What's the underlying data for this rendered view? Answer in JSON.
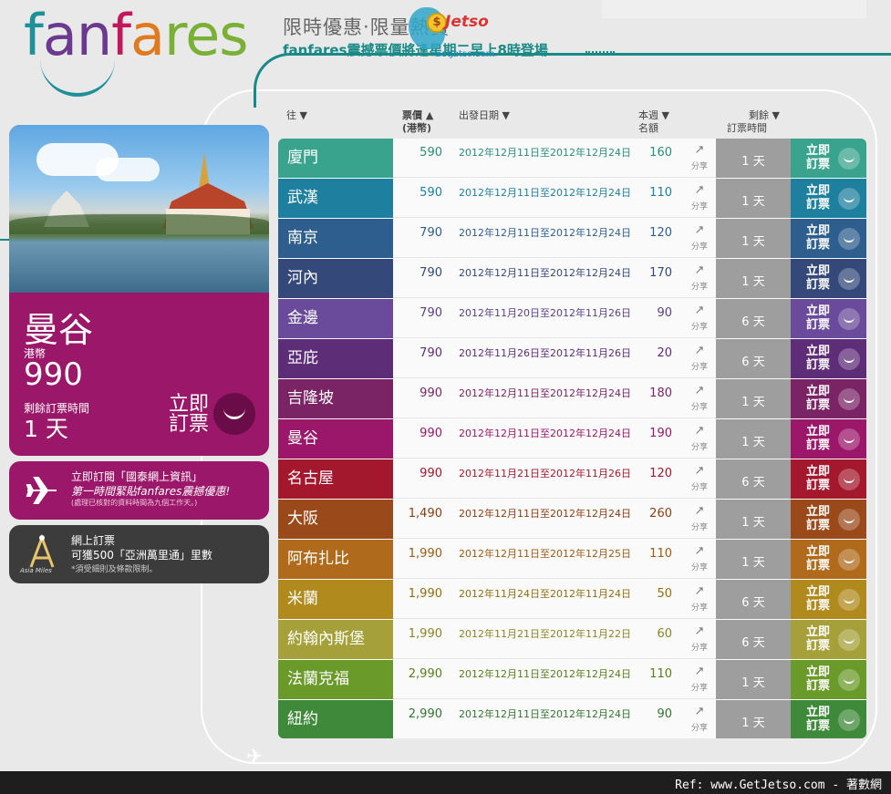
{
  "logo": {
    "parts": [
      "f",
      "an",
      "f",
      "a",
      "res"
    ]
  },
  "promo": {
    "title": "限時優惠‧限量熱賣",
    "subtitle": "fanfares震撼票價將逢星期二早上8時登場"
  },
  "watermark": {
    "coin": "$",
    "brand": "Jetso",
    "url": "GetJetso.com"
  },
  "feature": {
    "city": "曼谷",
    "currency_label": "港幣",
    "price": "990",
    "remaining_label": "剩餘訂票時間",
    "days": "1 天",
    "book_label": "立即訂票",
    "brand_color": "#9b1769"
  },
  "newsletter": {
    "line1": "立即訂閱「國泰網上資訊」",
    "line2": "第一時間緊貼fanfares震撼優惠!",
    "line3": "(處理已核對的資料時間為九個工作天。)"
  },
  "asia_miles": {
    "logo_text": "Asia Miles",
    "line1": "網上訂票",
    "line2": "可獲500「亞洲萬里通」里數",
    "line3": "*須受細則及條款限制。"
  },
  "table_headers": {
    "destination": "往 ▼",
    "fare": "票價 ▲",
    "fare_unit": "(港幣)",
    "departure": "出發日期 ▼",
    "seats": "本週 ▼",
    "seats_unit": "名額",
    "remaining": "剩餘 ▼",
    "remaining_unit": "訂票時間"
  },
  "rows": [
    {
      "city": "廈門",
      "price": "590",
      "dates": "2012年12月11日至2012年12月24日",
      "seats": "160",
      "days": "1 天",
      "color": "#3aa38e",
      "text_color": "#2b8c79"
    },
    {
      "city": "武漢",
      "price": "590",
      "dates": "2012年12月11日至2012年12月24日",
      "seats": "110",
      "days": "1 天",
      "color": "#1f7f9e",
      "text_color": "#1f7f9e"
    },
    {
      "city": "南京",
      "price": "790",
      "dates": "2012年12月11日至2012年12月24日",
      "seats": "120",
      "days": "1 天",
      "color": "#2e5e8e",
      "text_color": "#2e5e8e"
    },
    {
      "city": "河內",
      "price": "790",
      "dates": "2012年12月11日至2012年12月24日",
      "seats": "170",
      "days": "1 天",
      "color": "#34497a",
      "text_color": "#34497a"
    },
    {
      "city": "金邊",
      "price": "790",
      "dates": "2012年11月20日至2012年11月26日",
      "seats": "90",
      "days": "6 天",
      "color": "#6a4a9a",
      "text_color": "#5b3f86"
    },
    {
      "city": "亞庇",
      "price": "790",
      "dates": "2012年11月26日至2012年11月26日",
      "seats": "20",
      "days": "6 天",
      "color": "#5e2d78",
      "text_color": "#5e2d78"
    },
    {
      "city": "吉隆坡",
      "price": "990",
      "dates": "2012年12月11日至2012年12月24日",
      "seats": "180",
      "days": "1 天",
      "color": "#7a2466",
      "text_color": "#7a2466"
    },
    {
      "city": "曼谷",
      "price": "990",
      "dates": "2012年12月11日至2012年12月24日",
      "seats": "190",
      "days": "1 天",
      "color": "#9b1769",
      "text_color": "#9b1769"
    },
    {
      "city": "名古屋",
      "price": "990",
      "dates": "2012年11月21日至2012年11月26日",
      "seats": "120",
      "days": "6 天",
      "color": "#a3182d",
      "text_color": "#a3182d"
    },
    {
      "city": "大阪",
      "price": "1,490",
      "dates": "2012年12月11日至2012年12月24日",
      "seats": "260",
      "days": "1 天",
      "color": "#9a4a1a",
      "text_color": "#8a3e12"
    },
    {
      "city": "阿布扎比",
      "price": "1,990",
      "dates": "2012年12月11日至2012年12月25日",
      "seats": "110",
      "days": "1 天",
      "color": "#b06a1c",
      "text_color": "#9a5c14"
    },
    {
      "city": "米蘭",
      "price": "1,990",
      "dates": "2012年11月24日至2012年11月24日",
      "seats": "50",
      "days": "6 天",
      "color": "#b08a1c",
      "text_color": "#8e6e12"
    },
    {
      "city": "約翰內斯堡",
      "price": "1,990",
      "dates": "2012年11月21日至2012年11月22日",
      "seats": "60",
      "days": "6 天",
      "color": "#a6a03a",
      "text_color": "#8a8428"
    },
    {
      "city": "法蘭克福",
      "price": "2,990",
      "dates": "2012年12月11日至2012年12月24日",
      "seats": "110",
      "days": "1 天",
      "color": "#6a9a2a",
      "text_color": "#567e1e"
    },
    {
      "city": "紐約",
      "price": "2,990",
      "dates": "2012年12月11日至2012年12月24日",
      "seats": "90",
      "days": "1 天",
      "color": "#3f8a3a",
      "text_color": "#357530"
    }
  ],
  "row_labels": {
    "share": "分享",
    "share_icon": "↗",
    "book": "立即訂票"
  },
  "footer": {
    "ref": "Ref: www.GetJetso.com - 著數網"
  }
}
